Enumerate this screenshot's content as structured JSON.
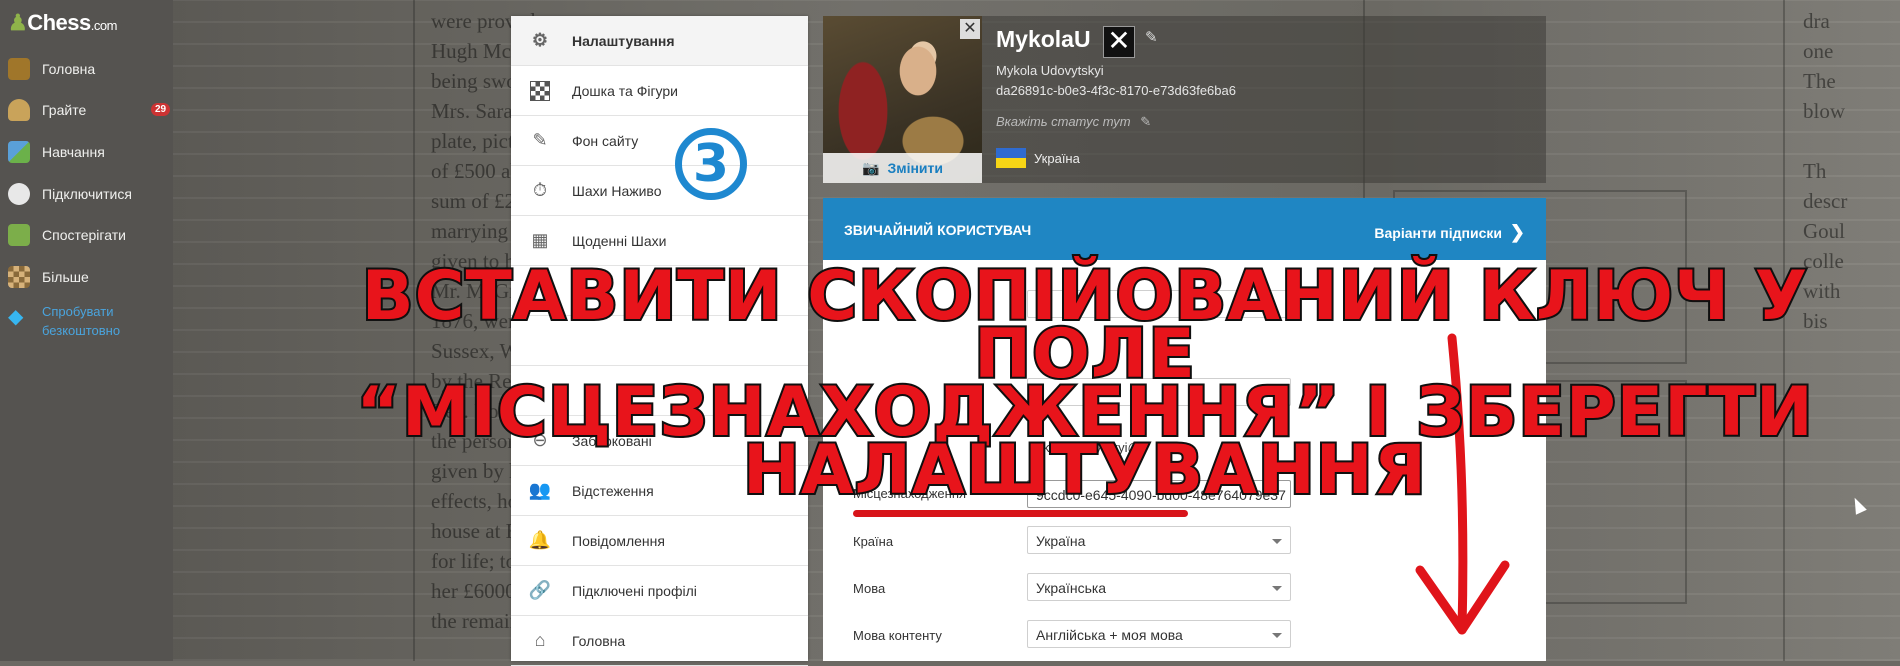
{
  "sidebar": {
    "logo": "Chess",
    "logo_suffix": ".com",
    "items": [
      {
        "label": "Головна",
        "icon": "pawn-home-icon"
      },
      {
        "label": "Грайте",
        "icon": "play-hand-icon",
        "badge": "29"
      },
      {
        "label": "Навчання",
        "icon": "learn-icon"
      },
      {
        "label": "Підключитися",
        "icon": "chat-bubble-icon"
      },
      {
        "label": "Спостерігати",
        "icon": "watch-icon"
      },
      {
        "label": "Більше",
        "icon": "more-board-icon"
      }
    ],
    "try_free": "Спробувати безкоштовно"
  },
  "menu": {
    "items": [
      {
        "label": "Налаштування",
        "icon": "gear-icon",
        "active": true
      },
      {
        "label": "Дошка та Фігури",
        "icon": "board-icon"
      },
      {
        "label": "Фон сайту",
        "icon": "edit-icon"
      },
      {
        "label": "Шахи Наживо",
        "icon": "stopwatch-icon"
      },
      {
        "label": "Щоденні Шахи",
        "icon": "calendar-icon"
      },
      {
        "label": "",
        "icon": "blank-icon"
      },
      {
        "label": "",
        "icon": "blank-icon"
      },
      {
        "label": "",
        "icon": "blank-icon"
      },
      {
        "label": "Заблоковані",
        "icon": "block-icon"
      },
      {
        "label": "Відстеження",
        "icon": "users-icon"
      },
      {
        "label": "Повідомлення",
        "icon": "bell-icon"
      },
      {
        "label": "Підключені профілі",
        "icon": "link-icon"
      },
      {
        "label": "Головна",
        "icon": "home-icon"
      }
    ]
  },
  "profile": {
    "username": "MykolaU",
    "real_name": "Mykola Udovytskyi",
    "id": "da26891c-b0e3-4f3c-8170-e73d63fe6ba6",
    "status_placeholder": "Вкажіть статус тут",
    "country": "Україна",
    "change_photo": "Змінити"
  },
  "membership": {
    "type": "ЗВИЧАЙНИЙ КОРИСТУВАЧ",
    "options_link": "Варіанти підписки"
  },
  "form": {
    "fields": [
      {
        "label": "Місцезнаходження",
        "value": "9ccdc0-e645-4090-bd00-48e764079e37"
      },
      {
        "label": "Країна",
        "value": "Україна"
      },
      {
        "label": "Мова",
        "value": "Українська"
      },
      {
        "label": "Мова контенту",
        "value": "Англійська + моя мова"
      }
    ],
    "partial_email": "kolaudovytskyi@"
  },
  "overlay": {
    "line1": "ВСТАВИТИ СКОПІЙОВАНИЙ КЛЮЧ У ПОЛЕ",
    "line2": "“МІСЦЕЗНАХОДЖЕННЯ” І ЗБЕРЕГТИ",
    "line3": "НАЛАШТУВАННЯ",
    "step_number": "3",
    "color": "#e8141b"
  }
}
